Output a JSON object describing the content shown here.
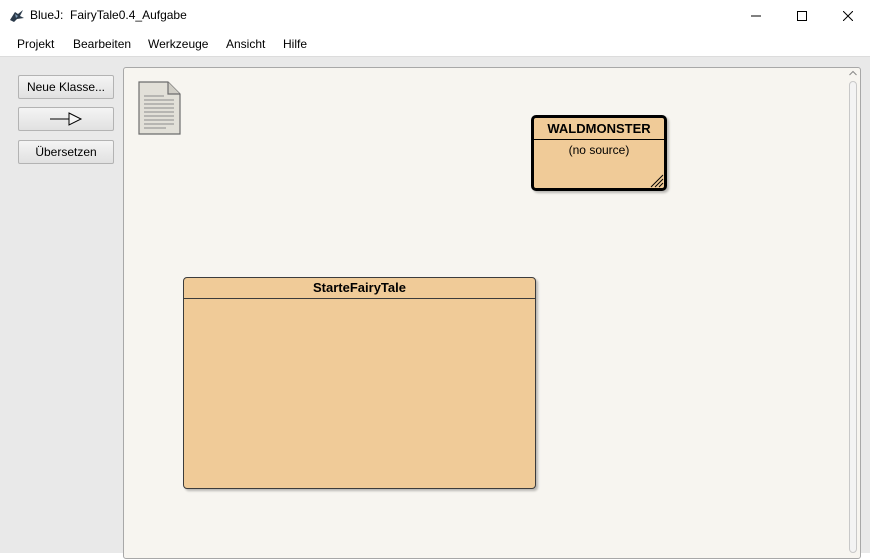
{
  "window": {
    "app_name": "BlueJ:",
    "project_name": "FairyTale0.4_Aufgabe"
  },
  "menu": {
    "items": [
      "Projekt",
      "Bearbeiten",
      "Werkzeuge",
      "Ansicht",
      "Hilfe"
    ]
  },
  "toolbar": {
    "new_class_label": "Neue Klasse...",
    "arrow_icon": "inheritance-arrow-icon",
    "compile_label": "Übersetzen"
  },
  "diagram": {
    "readme_icon": "document-icon",
    "classes": [
      {
        "name": "WALDMONSTER",
        "subtitle": "(no source)"
      },
      {
        "name": "StarteFairyTale"
      }
    ]
  },
  "colors": {
    "class_fill": "#f0cb98",
    "canvas_bg": "#f7f5f0",
    "panel_bg": "#e9e9e9"
  }
}
